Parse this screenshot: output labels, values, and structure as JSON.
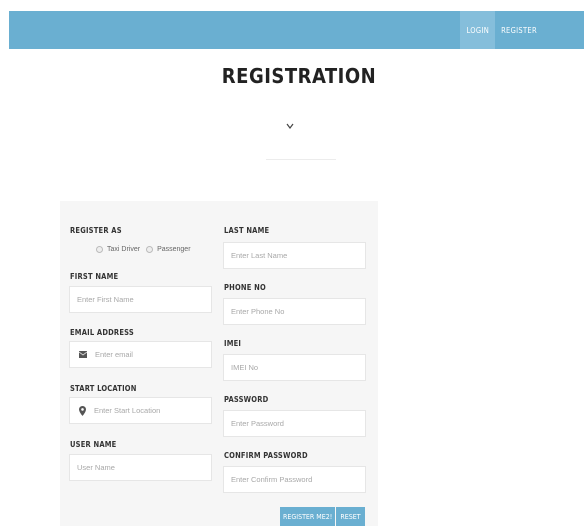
{
  "nav": {
    "login": "LOGIN",
    "register": "REGISTER"
  },
  "page": {
    "title": "REGISTRATION",
    "chevron": "chevron-down-icon"
  },
  "form": {
    "register_as": {
      "label": "REGISTER AS",
      "options": [
        "Taxi Driver",
        "Passenger"
      ]
    },
    "first_name": {
      "label": "FIRST NAME",
      "placeholder": "Enter First Name"
    },
    "email": {
      "label": "EMAIL ADDRESS",
      "placeholder": "Enter email",
      "icon": "envelope-icon"
    },
    "start_location": {
      "label": "START LOCATION",
      "placeholder": "Enter Start Location",
      "icon": "map-marker-icon"
    },
    "user_name": {
      "label": "USER NAME",
      "placeholder": "User Name"
    },
    "last_name": {
      "label": "LAST NAME",
      "placeholder": "Enter Last Name"
    },
    "phone": {
      "label": "PHONE NO",
      "placeholder": "Enter Phone No"
    },
    "imei": {
      "label": "IMEI",
      "placeholder": "IMEI No"
    },
    "password": {
      "label": "PASSWORD",
      "placeholder": "Enter Password"
    },
    "confirm_password": {
      "label": "CONFIRM PASSWORD",
      "placeholder": "Enter Confirm Password"
    },
    "register_button": "REGISTER ME2!",
    "reset_button": "RESET"
  },
  "colors": {
    "navbar": "#6aafd1",
    "nav_active": "#85bedb",
    "panel": "#f6f6f6",
    "button": "#6aafd1"
  }
}
